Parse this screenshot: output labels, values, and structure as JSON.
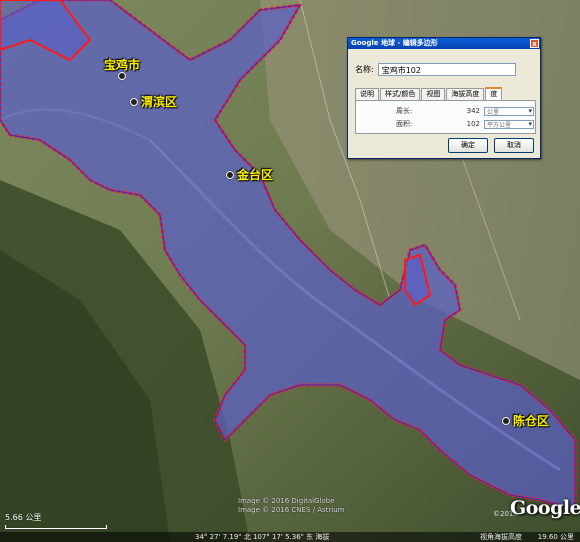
{
  "places": [
    {
      "name": "宝鸡市"
    },
    {
      "name": "渭滨区"
    },
    {
      "name": "金台区"
    },
    {
      "name": "陈仓区"
    }
  ],
  "dialog": {
    "title": "Google 地球 - 编辑多边形",
    "close_glyph": "x",
    "name_label": "名称:",
    "name_value": "宝鸡市102",
    "tabs": [
      "说明",
      "样式/颜色",
      "视图",
      "海拔高度",
      "度"
    ],
    "active_tab_index": 4,
    "perimeter_label": "周长:",
    "perimeter_value": "342",
    "perimeter_unit": "公里",
    "area_label": "面积:",
    "area_value": "102",
    "area_unit": "平方公里",
    "ok_label": "确定",
    "cancel_label": "取消"
  },
  "credits": {
    "line1": "Image © 2016 DigitalGlobe",
    "line2": "Image © 2016 CNES / Astrium"
  },
  "scale_label": "5.66 公里",
  "status": {
    "coords": "34° 27' 7.19\" 北   107° 17' 5.36\" 东 海拔",
    "altitude": "视角海拔高度",
    "eye_alt": "19.60 公里"
  },
  "brand": {
    "logo": "Google",
    "yinpu": "©2016"
  },
  "colors": {
    "polygon_fill": "#5a5fc8",
    "polygon_stroke": "#ff1a1a",
    "label_text": "#fff200",
    "dialog_title": "#0a5fd8"
  }
}
